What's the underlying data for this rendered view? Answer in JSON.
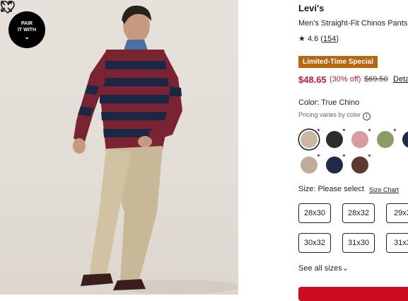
{
  "pair_badge": {
    "line1": "PAIR",
    "line2": "IT WITH",
    "chevron": "⌄"
  },
  "product": {
    "brand": "Levi's",
    "name": "Men's Straight-Fit Chinos Pants",
    "rating_star": "★",
    "rating": "4.6",
    "review_count": "154",
    "promo_badge": "Limited-Time Special",
    "sale_price": "$48.65",
    "discount": "(30% off)",
    "original_price": "$69.50",
    "details_link": "Deta"
  },
  "color": {
    "label": "Color: True Chino",
    "pricing_note": "Pricing varies by color",
    "info_icon": "i",
    "swatches": [
      {
        "name": "True Chino",
        "hex": "#cbb8a0",
        "selected": true
      },
      {
        "name": "Black",
        "hex": "#2c2c2c"
      },
      {
        "name": "Pink",
        "hex": "#d89aa3"
      },
      {
        "name": "Olive",
        "hex": "#8e9a6a"
      },
      {
        "name": "Navy",
        "hex": "#1f2d4a"
      },
      {
        "name": "Taupe",
        "hex": "#bfab98"
      },
      {
        "name": "Dark Navy",
        "hex": "#1e2a48"
      },
      {
        "name": "Brown Plaid",
        "hex": "#5a3a2c"
      }
    ]
  },
  "size": {
    "label": "Size: Please select",
    "chart_link": "Size Chart",
    "options": [
      "28x30",
      "28x32",
      "29x3",
      "30x32",
      "31x30",
      "31x3"
    ],
    "see_all": "See all sizes",
    "see_all_chevron": "⌄"
  },
  "colors": {
    "accent_red": "#d0143c",
    "promo_bg": "#b8670f",
    "cta_red": "#cc0c20"
  }
}
